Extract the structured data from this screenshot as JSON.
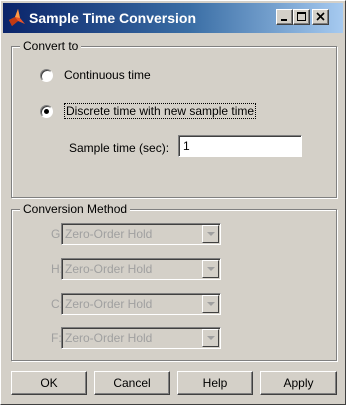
{
  "window": {
    "title": "Sample Time Conversion"
  },
  "convert_to": {
    "legend": "Convert to",
    "options": [
      {
        "label": "Continuous time",
        "selected": false
      },
      {
        "label": "Discrete time with new sample time",
        "selected": true
      }
    ],
    "sample_time_label": "Sample time (sec):",
    "sample_time_value": "1"
  },
  "conversion_method": {
    "legend": "Conversion Method",
    "enabled": false,
    "rows": [
      {
        "letter": "G:",
        "value": "Zero-Order Hold"
      },
      {
        "letter": "H:",
        "value": "Zero-Order Hold"
      },
      {
        "letter": "C:",
        "value": "Zero-Order Hold"
      },
      {
        "letter": "F:",
        "value": "Zero-Order Hold"
      }
    ]
  },
  "buttons": {
    "ok": "OK",
    "cancel": "Cancel",
    "help": "Help",
    "apply": "Apply"
  },
  "colors": {
    "titlebar_start": "#0a246a",
    "titlebar_end": "#a6caf0",
    "face": "#d4d0c8",
    "disabled_text": "#a0a0a0"
  }
}
